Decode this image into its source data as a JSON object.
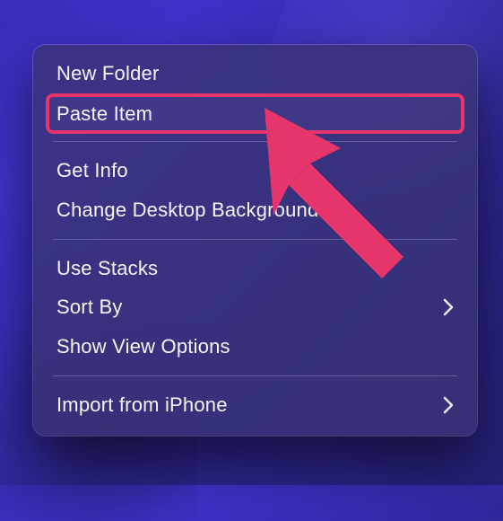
{
  "context_menu": {
    "groups": [
      [
        {
          "id": "new-folder",
          "label": "New Folder",
          "submenu": false,
          "highlighted": false
        },
        {
          "id": "paste-item",
          "label": "Paste Item",
          "submenu": false,
          "highlighted": true
        }
      ],
      [
        {
          "id": "get-info",
          "label": "Get Info",
          "submenu": false,
          "highlighted": false
        },
        {
          "id": "change-bg",
          "label": "Change Desktop Background…",
          "submenu": false,
          "highlighted": false
        }
      ],
      [
        {
          "id": "use-stacks",
          "label": "Use Stacks",
          "submenu": false,
          "highlighted": false
        },
        {
          "id": "sort-by",
          "label": "Sort By",
          "submenu": true,
          "highlighted": false
        },
        {
          "id": "show-view",
          "label": "Show View Options",
          "submenu": false,
          "highlighted": false
        }
      ],
      [
        {
          "id": "import-iphone",
          "label": "Import from iPhone",
          "submenu": true,
          "highlighted": false
        }
      ]
    ]
  },
  "annotation": {
    "arrow_color": "#e6356b"
  }
}
